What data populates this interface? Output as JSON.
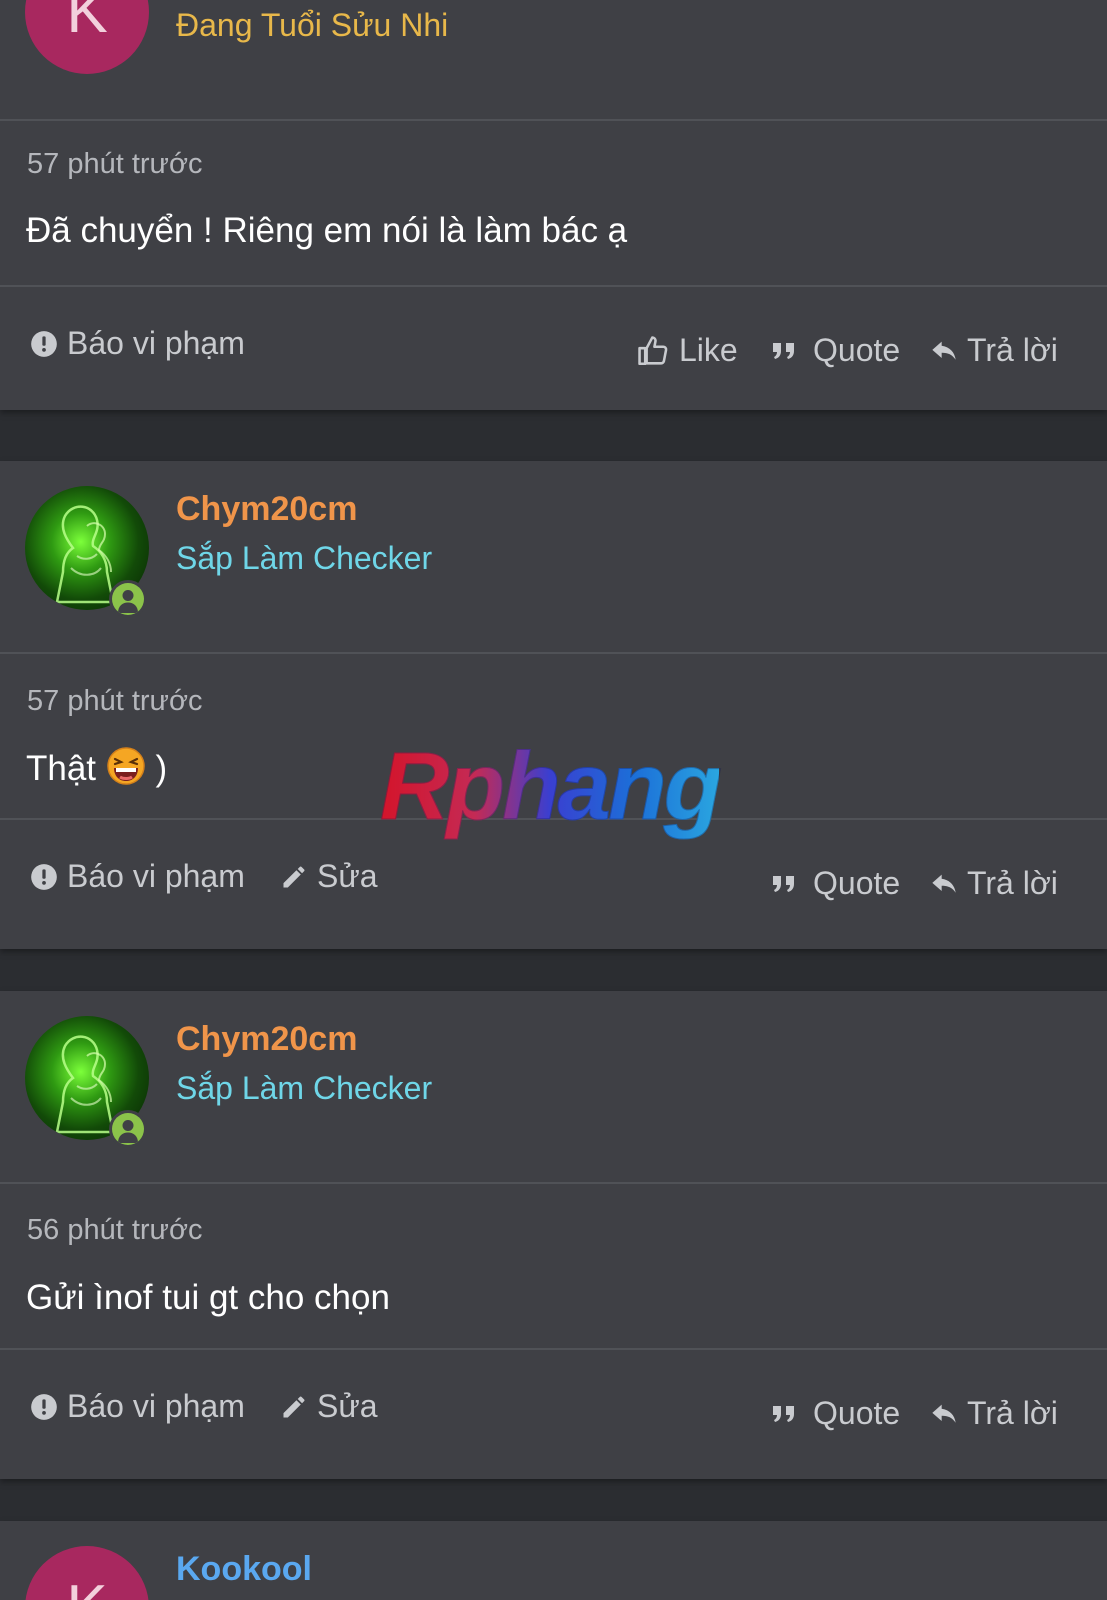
{
  "posts": [
    {
      "avatar_letter": "K",
      "avatar_color": "#a8285f",
      "username": "",
      "user_title": "Đang Tuổi Sửu Nhi",
      "user_title_color": "#e8b84a",
      "timestamp": "57 phút trước",
      "message": "Đã chuyển ! Riêng em nói là làm bác ạ",
      "actions": {
        "report": "Báo vi phạm",
        "like": "Like",
        "quote": "Quote",
        "reply": "Trả lời"
      }
    },
    {
      "username": "Chym20cm",
      "username_color": "#f0954a",
      "user_title": "Sắp Làm Checker",
      "user_title_color": "#6fd6e8",
      "timestamp": "57 phút trước",
      "message": "Thật",
      "message_suffix": ")",
      "actions": {
        "report": "Báo vi phạm",
        "edit": "Sửa",
        "quote": "Quote",
        "reply": "Trả lời"
      }
    },
    {
      "username": "Chym20cm",
      "username_color": "#f0954a",
      "user_title": "Sắp Làm Checker",
      "user_title_color": "#6fd6e8",
      "timestamp": "56 phút trước",
      "message": "Gửi ìnof tui gt cho chọn",
      "actions": {
        "report": "Báo vi phạm",
        "edit": "Sửa",
        "quote": "Quote",
        "reply": "Trả lời"
      }
    },
    {
      "avatar_letter": "K",
      "avatar_color": "#a8285f",
      "username": "Kookool",
      "username_color": "#5aa8f0"
    }
  ],
  "watermark": "Rphang",
  "icons": {
    "report": "alert-circle-icon",
    "like": "thumbs-up-icon",
    "quote": "quote-icon",
    "reply": "reply-arrow-icon",
    "edit": "pencil-icon",
    "online": "online-user-icon",
    "emoji": "laughing-emoji-icon"
  }
}
